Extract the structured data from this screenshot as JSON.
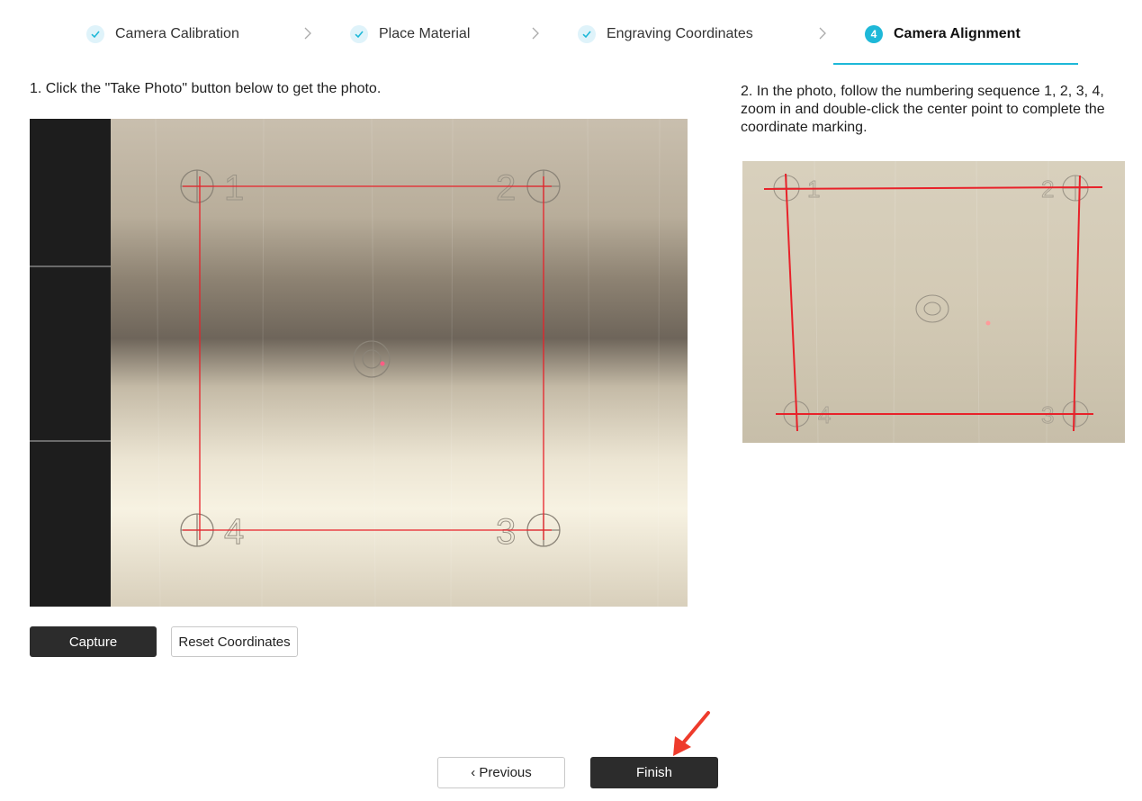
{
  "steps": [
    {
      "label": "Camera Calibration",
      "state": "done"
    },
    {
      "label": "Place Material",
      "state": "done"
    },
    {
      "label": "Engraving Coordinates",
      "state": "done"
    },
    {
      "number": "4",
      "label": "Camera Alignment",
      "state": "active"
    }
  ],
  "instructions": {
    "step1": "1. Click the \"Take Photo\" button below to get the photo.",
    "step2": "2. In the photo, follow the numbering sequence 1, 2, 3, 4, zoom in and double-click the center point to complete the coordinate marking."
  },
  "photo_labels": [
    "1",
    "2",
    "3",
    "4"
  ],
  "buttons": {
    "capture": "Capture",
    "reset": "Reset Coordinates",
    "previous": "‹  Previous",
    "finish": "Finish"
  },
  "colors": {
    "accent": "#1eb8d8",
    "marking_line": "#e8222a",
    "annotation_arrow": "#ee3b2c",
    "dark_button": "#2c2c2c"
  },
  "icons": {
    "done_step": "check-icon",
    "separator": "chevron-right-icon",
    "annotation": "red-arrow-icon"
  }
}
